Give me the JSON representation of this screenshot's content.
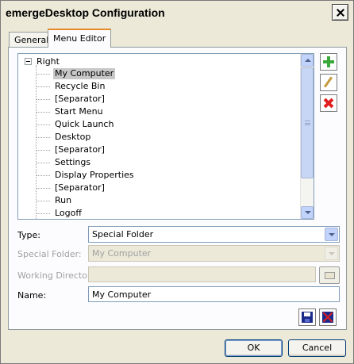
{
  "window": {
    "title": "emergeDesktop Configuration"
  },
  "tabs": [
    {
      "label": "General",
      "active": false
    },
    {
      "label": "Menu Editor",
      "active": true
    }
  ],
  "tree": {
    "root_label": "Right",
    "items": [
      {
        "label": "My Computer",
        "selected": true
      },
      {
        "label": "Recycle Bin"
      },
      {
        "label": "[Separator]"
      },
      {
        "label": "Start Menu"
      },
      {
        "label": "Quick Launch"
      },
      {
        "label": "Desktop"
      },
      {
        "label": "[Separator]"
      },
      {
        "label": "Settings"
      },
      {
        "label": "Display Properties"
      },
      {
        "label": "[Separator]"
      },
      {
        "label": "Run"
      },
      {
        "label": "Logoff"
      }
    ]
  },
  "side_buttons": {
    "add_icon": "plus-icon",
    "edit_icon": "pencil-icon",
    "delete_icon": "x-icon"
  },
  "form": {
    "type_label": "Type:",
    "type_value": "Special Folder",
    "special_folder_label": "Special Folder:",
    "special_folder_value": "My Computer",
    "working_dir_label": "Working Directory:",
    "working_dir_value": "",
    "name_label": "Name:",
    "name_value": "My Computer"
  },
  "buttons": {
    "ok": "OK",
    "cancel": "Cancel"
  },
  "colors": {
    "dialog_bg": "#ece9d8",
    "selection_bg": "#c8c8c8",
    "add_green": "#3aa83a",
    "delete_red": "#e02020"
  }
}
